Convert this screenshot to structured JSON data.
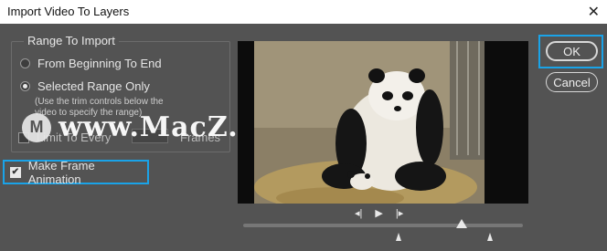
{
  "window": {
    "title": "Import Video To Layers",
    "close": "✕"
  },
  "range": {
    "legend": "Range To Import",
    "options": [
      {
        "label": "From Beginning To End",
        "selected": false
      },
      {
        "label": "Selected Range Only",
        "selected": true
      }
    ],
    "hint": "(Use the trim controls below the video to specify the range)"
  },
  "limit": {
    "label": "Limit To Every",
    "checked": false,
    "value": "",
    "unit": "Frames"
  },
  "make_frame": {
    "label": "Make Frame Animation",
    "checked": true
  },
  "watermark": {
    "logo": "M",
    "text": "www.MacZ.com"
  },
  "transport": {
    "prev": "◂|",
    "play": "▶",
    "next": "|▸",
    "playhead_fraction": 0.78
  },
  "buttons": {
    "ok": "OK",
    "cancel": "Cancel"
  },
  "colors": {
    "accent": "#1aa3e8",
    "background": "#535353"
  }
}
